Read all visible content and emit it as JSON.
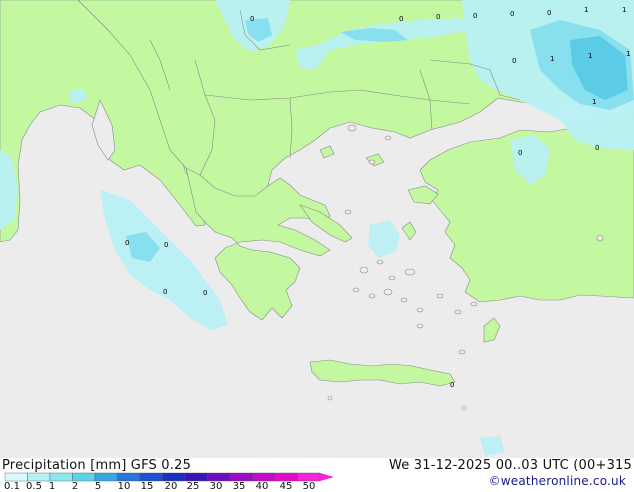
{
  "map": {
    "title_left": "Precipitation [mm]  GFS 0.25",
    "title_right": "We 31-12-2025 00..03 UTC (00+315",
    "credit": "©weatheronline.co.uk",
    "colors": {
      "sea": "#ececec",
      "land": "#c3f7a0",
      "border": "#8a8a8a",
      "precip_light": "#b8f0f5",
      "precip_mid": "#88e0ee",
      "precip_strong": "#5ccbe6"
    },
    "legend": {
      "labels": [
        "0.1",
        "0.5",
        "1",
        "2",
        "5",
        "10",
        "15",
        "20",
        "25",
        "30",
        "35",
        "40",
        "45",
        "50"
      ],
      "colors": [
        "#d8fafc",
        "#b4f0f6",
        "#8ae6f0",
        "#5cd2ea",
        "#38a6e0",
        "#2877dc",
        "#1f4fd2",
        "#1c2ec4",
        "#3a12b8",
        "#6a0ec0",
        "#9b0cc6",
        "#c40cc8",
        "#e40ccc",
        "#f224d8"
      ]
    },
    "precip_labels": [
      {
        "text": "0"
      },
      {
        "text": "0"
      },
      {
        "text": "0"
      },
      {
        "text": "0"
      },
      {
        "text": "0"
      },
      {
        "text": "0"
      },
      {
        "text": "1"
      },
      {
        "text": "1"
      },
      {
        "text": "0"
      },
      {
        "text": "1"
      },
      {
        "text": "1"
      },
      {
        "text": "1"
      },
      {
        "text": "1"
      },
      {
        "text": "0"
      },
      {
        "text": "0"
      },
      {
        "text": "0"
      },
      {
        "text": "0"
      },
      {
        "text": "0"
      },
      {
        "text": "0"
      },
      {
        "text": "0"
      }
    ]
  }
}
